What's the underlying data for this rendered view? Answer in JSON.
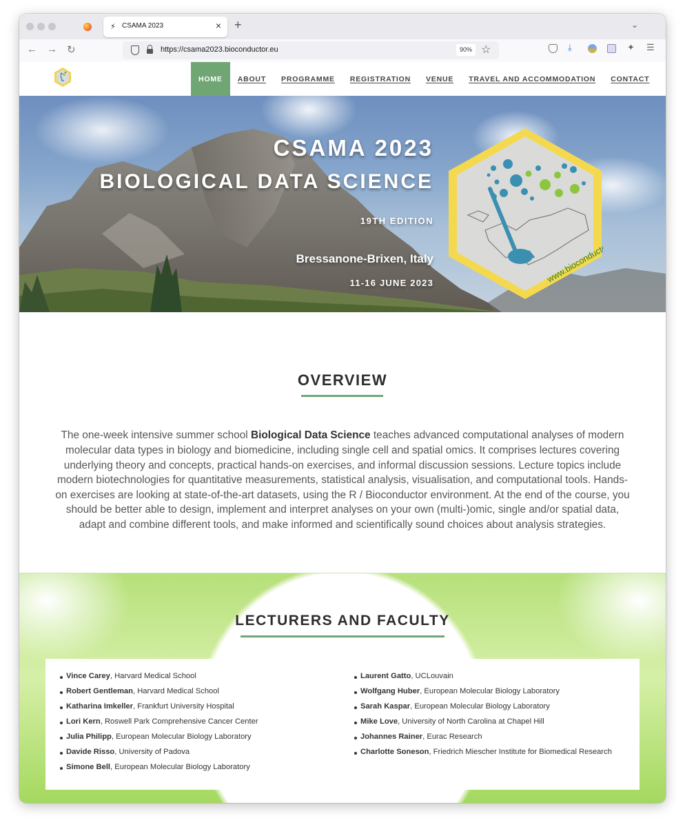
{
  "browser": {
    "tab_title": "CSAMA 2023",
    "tab_favicon": "⚡",
    "url": "https://csama2023.bioconductor.eu",
    "zoom": "90%",
    "new_tab_glyph": "+",
    "close_glyph": "×",
    "icons": [
      "back-icon",
      "forward-icon",
      "reload-icon",
      "shield-icon",
      "lock-icon",
      "star-icon",
      "pocket-icon",
      "download-icon",
      "extension-icon",
      "puzzle-icon",
      "menu-icon"
    ]
  },
  "nav": {
    "items": [
      {
        "label": "HOME"
      },
      {
        "label": "ABOUT"
      },
      {
        "label": "PROGRAMME"
      },
      {
        "label": "REGISTRATION"
      },
      {
        "label": "VENUE"
      },
      {
        "label": "TRAVEL AND ACCOMMODATION"
      },
      {
        "label": "CONTACT"
      }
    ],
    "active": "HOME",
    "active_color": "#6fa673"
  },
  "hero": {
    "title": "CSAMA 2023",
    "subtitle": "BIOLOGICAL DATA SCIENCE",
    "edition": "19TH EDITION",
    "location": "Bressanone-Brixen, Italy",
    "dates": "11-16 JUNE 2023",
    "sticker_url": "www.bioconductor.eu"
  },
  "overview": {
    "title": "OVERVIEW",
    "text_before": "The one-week intensive summer school ",
    "text_bold": "Biological Data Science",
    "text_after": " teaches advanced computational analyses of modern molecular data types in biology and biomedicine, including single cell and spatial omics. It comprises lectures covering underlying theory and concepts, practical hands-on exercises, and informal discussion sessions. Lecture topics include modern biotechnologies for quantitative measurements, statistical analysis, visualisation, and computational tools. Hands-on exercises are looking at state-of-the-art datasets, using the R / Bioconductor environment. At the end of the course, you should be better able to design, implement and interpret analyses on your own (multi-)omic, single and/or spatial data, adapt and combine different tools, and make informed and scientifically sound choices about analysis strategies."
  },
  "lecturers": {
    "title": "LECTURERS AND FACULTY",
    "left": [
      {
        "name": "Vince Carey",
        "affiliation": ", Harvard Medical School"
      },
      {
        "name": "Robert Gentleman",
        "affiliation": ", Harvard Medical School"
      },
      {
        "name": "Katharina Imkeller",
        "affiliation": ", Frankfurt University Hospital"
      },
      {
        "name": "Lori Kern",
        "affiliation": ", Roswell Park Comprehensive Cancer Center"
      },
      {
        "name": "Julia Philipp",
        "affiliation": ", European Molecular Biology Laboratory"
      },
      {
        "name": "Davide Risso",
        "affiliation": ", University of Padova"
      },
      {
        "name": "Simone Bell",
        "affiliation": ", European Molecular Biology Laboratory"
      }
    ],
    "right": [
      {
        "name": "Laurent Gatto",
        "affiliation": ", UCLouvain"
      },
      {
        "name": "Wolfgang Huber",
        "affiliation": ", European Molecular Biology Laboratory"
      },
      {
        "name": "Sarah Kaspar",
        "affiliation": ", European Molecular Biology Laboratory"
      },
      {
        "name": "Mike Love",
        "affiliation": ", University of North Carolina at Chapel Hill"
      },
      {
        "name": "Johannes Rainer",
        "affiliation": ", Eurac Research"
      },
      {
        "name": "Charlotte Soneson",
        "affiliation": ", Friedrich Miescher Institute for Biomedical Research"
      }
    ]
  }
}
